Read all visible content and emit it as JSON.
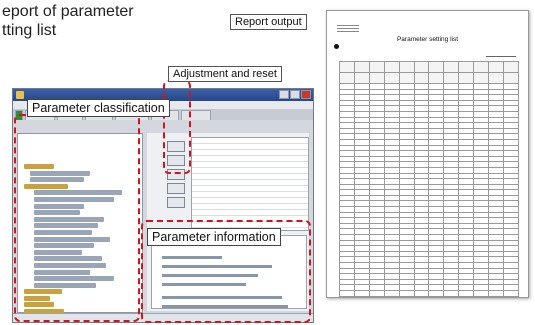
{
  "heading": {
    "line1": "eport of parameter",
    "line2": "tting list"
  },
  "callouts": {
    "report_output": "Report output",
    "adjustment_reset": "Adjustment and reset",
    "parameter_classification": "Parameter classification",
    "parameter_information": "Parameter information"
  },
  "report": {
    "title": "Parameter setting list"
  },
  "colors": {
    "highlight": "#d3141a",
    "active_tab": "#2f8a3a",
    "titlebar": "#27468a"
  },
  "icons": [
    "minimize-icon",
    "maximize-icon",
    "close-icon",
    "app-icon",
    "bullet-icon"
  ]
}
